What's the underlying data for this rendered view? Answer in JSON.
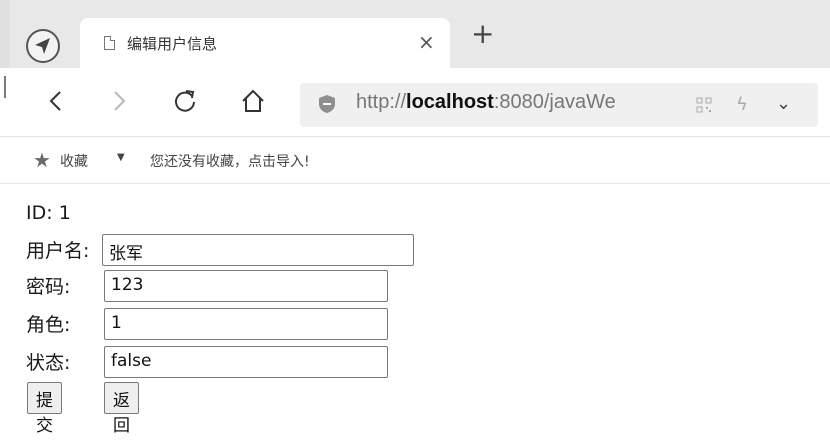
{
  "browser": {
    "tab_title": "编辑用户信息",
    "tab_close": "×",
    "new_tab": "+",
    "url_scheme": "http://",
    "url_host": "localhost",
    "url_rest": ":8080/javaWe",
    "bookmarks_label": "收藏",
    "bookmarks_hint": "您还没有收藏，点击导入!"
  },
  "form": {
    "id_label": "ID:",
    "id_value": "1",
    "username_label": "用户名:",
    "username_value": "张军",
    "password_label": "密码:",
    "password_value": "123",
    "role_label": "角色:",
    "role_value": "1",
    "status_label": "状态:",
    "status_value": "false",
    "submit_label": "提交",
    "back_label": "返回"
  }
}
